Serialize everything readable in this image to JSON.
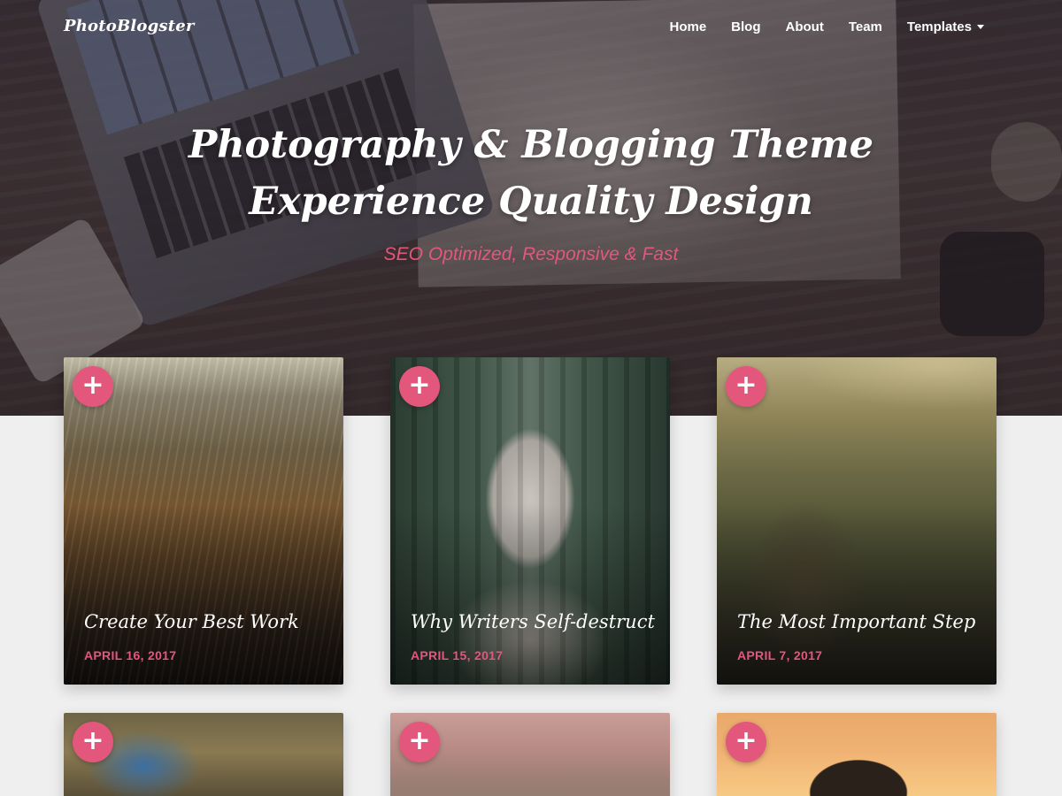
{
  "site": {
    "logo": "PhotoBlogster"
  },
  "nav": {
    "items": [
      {
        "label": "Home"
      },
      {
        "label": "Blog"
      },
      {
        "label": "About"
      },
      {
        "label": "Team"
      },
      {
        "label": "Templates",
        "has_dropdown": true
      }
    ]
  },
  "hero": {
    "title_line1": "Photography & Blogging Theme",
    "title_line2": "Experience Quality Design",
    "subtitle": "SEO Optimized, Responsive & Fast"
  },
  "colors": {
    "accent": "#e3577d",
    "page_background": "#efefef",
    "text_light": "#ffffff"
  },
  "icons": {
    "card_action": "plus-icon",
    "dropdown": "caret-down-icon"
  },
  "posts": [
    {
      "title": "Create Your Best Work",
      "date": "APRIL 16, 2017",
      "plus": "+"
    },
    {
      "title": "Why Writers Self-destruct",
      "date": "APRIL 15, 2017",
      "plus": "+"
    },
    {
      "title": "The Most Important Step",
      "date": "APRIL 7, 2017",
      "plus": "+"
    },
    {
      "title": "",
      "date": "",
      "plus": "+"
    },
    {
      "title": "",
      "date": "",
      "plus": "+"
    },
    {
      "title": "",
      "date": "",
      "plus": "+"
    }
  ]
}
